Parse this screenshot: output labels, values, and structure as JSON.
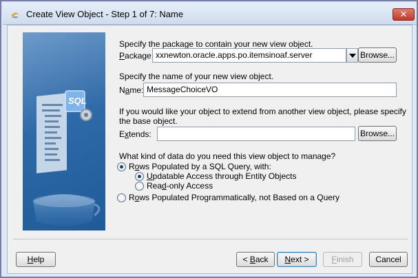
{
  "window": {
    "title": "Create View Object - Step 1 of 7: Name",
    "close_label": "✕"
  },
  "package": {
    "prompt": "Specify the package to contain your new view object.",
    "label_pre": "",
    "label_mn": "P",
    "label_post": "ackage:",
    "value": "xxnewton.oracle.apps.po.itemsinoaf.server",
    "browse_label": "Browse..."
  },
  "name": {
    "prompt": "Specify the name of your new view object.",
    "label_pre": "N",
    "label_mn": "a",
    "label_post": "me:",
    "value": "MessageChoiceVO"
  },
  "extends": {
    "prompt_line1": "If you would like your object to extend from another view object, please specify",
    "prompt_line2": "the base object.",
    "label_pre": "E",
    "label_mn": "x",
    "label_post": "tends:",
    "value": "",
    "browse_label": "Browse..."
  },
  "data_source": {
    "question": "What kind of data do you need this view object to manage?",
    "opt_sql_pre": "R",
    "opt_sql_mn": "o",
    "opt_sql_post": "ws Populated by a SQL Query, with:",
    "opt_updatable_mn": "U",
    "opt_updatable_post": "pdatable Access through Entity Objects",
    "opt_readonly_pre": "Rea",
    "opt_readonly_mn": "d",
    "opt_readonly_post": "-only Access",
    "opt_prog_pre": "R",
    "opt_prog_mn": "o",
    "opt_prog_post": "ws Populated Programmatically, not Based on a Query",
    "selected_primary": "sql",
    "selected_secondary": "updatable"
  },
  "side_panel": {
    "badge": "SQL",
    "colors": {
      "panel_top": "#6e9bc9",
      "panel_bottom": "#1f5a99"
    }
  },
  "footer": {
    "help_mn": "H",
    "help_post": "elp",
    "back_pre": "< ",
    "back_mn": "B",
    "back_post": "ack",
    "next_mn": "N",
    "next_post": "ext >",
    "finish_mn": "F",
    "finish_post": "inish",
    "cancel_label": "Cancel"
  },
  "colors": {
    "title_bar": "#cfdcee",
    "close_button": "#c0392b",
    "dialog_bg": "#f0f0f0"
  }
}
